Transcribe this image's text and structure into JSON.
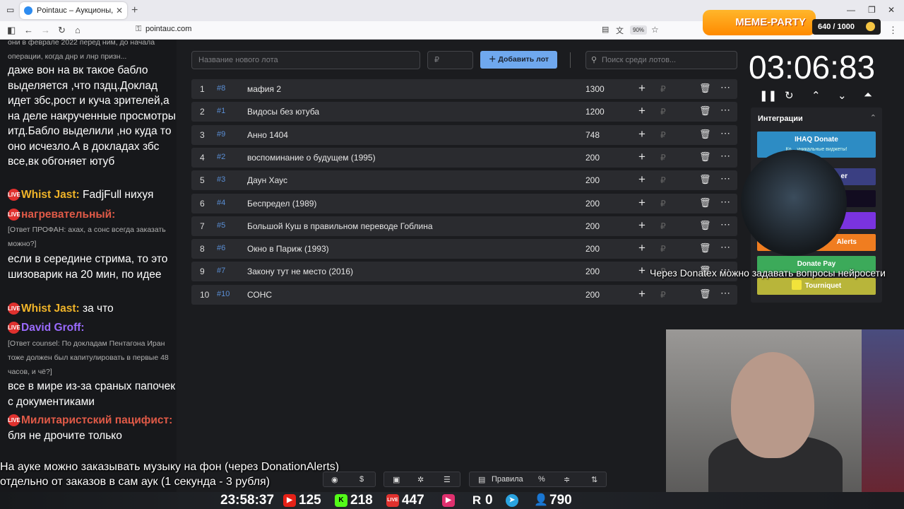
{
  "browser": {
    "tab_title": "Pointauc – Аукционы, лотереи",
    "url": "pointauc.com",
    "zoom": "90%"
  },
  "chat": {
    "messages": [
      {
        "text": "они в феврале 2022 перед ним, до начала операции, когда днр и лнр призн...",
        "small": true
      },
      {
        "text": "даже вон на вк такое бабло выделяется ,что пздц.Доклад идет збс,рост и куча зрителей,а на деле накрученные просмотры итд.Бабло выделили ,но куда то оно исчезло.А в докладах збс все,вк обгоняет ютуб"
      },
      {
        "nick": "Whist Jast:",
        "nick_color": "#f0b429",
        "text": "FadjFull нихуя"
      },
      {
        "nick": "нагревательный:",
        "nick_color": "#e05a47",
        "text": ""
      },
      {
        "text": "[Ответ ПРОФАН: ахах, а сонс всегда заказать можно?]",
        "small": true
      },
      {
        "text": "если в середине стрима, то это шизоварик на 20 мин, по идее"
      },
      {
        "nick": "Whist Jast:",
        "nick_color": "#f0b429",
        "text": "за что"
      },
      {
        "nick": "David Groff:",
        "nick_color": "#9b6bff",
        "text": ""
      },
      {
        "text": "[Ответ counsel: По докладам Пентагона Иран тоже должен был капитулировать в первые 48 часов, и чё?]",
        "small": true
      },
      {
        "text": "все в мире из-за сраных папочек с документиками"
      },
      {
        "nick": "Милитаристский пацифист:",
        "nick_color": "#e05a47",
        "text": "бля не дрочите только"
      }
    ],
    "overlay_line1": "На ауке можно заказывать музыку на фон (через DonationAlerts)",
    "overlay_line2": "отдельно от заказов в сам аук (1 секунда - 3 рубля)"
  },
  "toolbar": {
    "new_lot_placeholder": "Название нового лота",
    "amount_placeholder": "₽",
    "add_lot_label": "Добавить лот",
    "search_placeholder": "Поиск среди лотов..."
  },
  "lots": [
    {
      "idx": "1",
      "fid": "#8",
      "name": "мафия 2",
      "amount": "1300"
    },
    {
      "idx": "2",
      "fid": "#1",
      "name": "Видосы без ютуба",
      "amount": "1200"
    },
    {
      "idx": "3",
      "fid": "#9",
      "name": "Анно 1404",
      "amount": "748"
    },
    {
      "idx": "4",
      "fid": "#2",
      "name": "воспоминание о будущем (1995)",
      "amount": "200"
    },
    {
      "idx": "5",
      "fid": "#3",
      "name": "Даун Хаус",
      "amount": "200"
    },
    {
      "idx": "6",
      "fid": "#4",
      "name": "Беспредел (1989)",
      "amount": "200"
    },
    {
      "idx": "7",
      "fid": "#5",
      "name": "Большой Куш в правильном переводе Гоблина",
      "amount": "200"
    },
    {
      "idx": "8",
      "fid": "#6",
      "name": "Окно в Париж (1993)",
      "amount": "200"
    },
    {
      "idx": "9",
      "fid": "#7",
      "name": "Закону тут не место (2016)",
      "amount": "200"
    },
    {
      "idx": "10",
      "fid": "#10",
      "name": "СОНС",
      "amount": "200"
    }
  ],
  "timer": "03:06:83",
  "integrations": {
    "title": "Интеграции",
    "ihaq": "IHAQ Donate",
    "ihaq_sub": "Ко... уникальные виджеты!",
    "er": "er",
    "alerts": "Alerts",
    "donatepay": "Donate Pay",
    "tourniquet": "Tourniquet"
  },
  "overlay_donatex": "Через Donatex можно задавать вопросы нейросети",
  "meme_party": {
    "logo": "MEME-PARTY",
    "counter": "640 / 1000"
  },
  "bottom_toolbar": {
    "rules": "Правила",
    "percent": "%"
  },
  "status": {
    "time": "23:58:37",
    "youtube": "125",
    "kick": "218",
    "live": "447",
    "rumble": "0",
    "viewers": "790"
  }
}
